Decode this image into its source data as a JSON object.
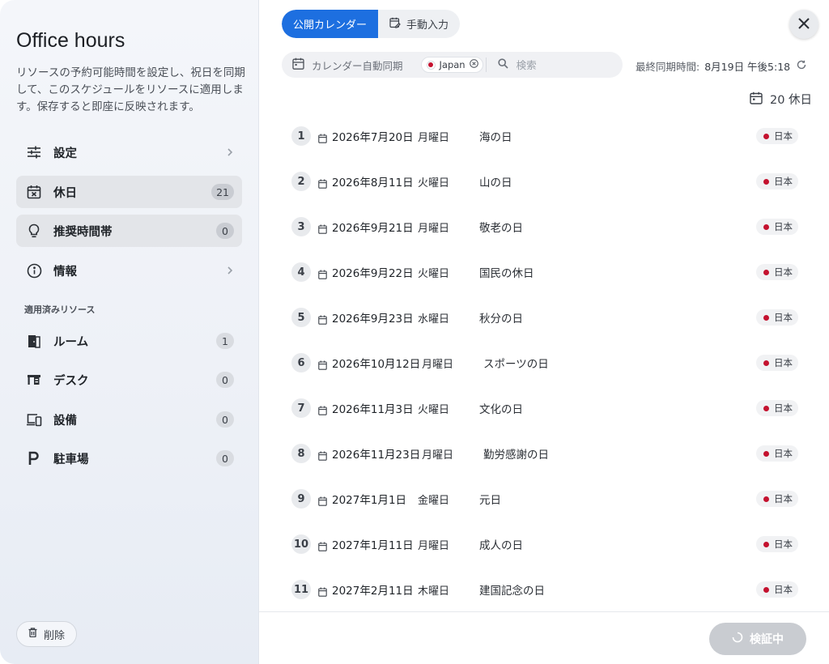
{
  "sidebar": {
    "title": "Office hours",
    "description": "リソースの予約可能時間を設定し、祝日を同期して、このスケジュールをリソースに適用します。保存すると即座に反映されます。",
    "nav": [
      {
        "label": "設定",
        "icon": "sliders-icon",
        "badge": null
      },
      {
        "label": "休日",
        "icon": "calendar-x-icon",
        "badge": "21",
        "active": true
      },
      {
        "label": "推奨時間帯",
        "icon": "lightbulb-icon",
        "badge": "0",
        "active": true
      },
      {
        "label": "情報",
        "icon": "info-icon",
        "badge": null
      }
    ],
    "resources_label": "適用済みリソース",
    "resources": [
      {
        "label": "ルーム",
        "icon": "door-icon",
        "badge": "1"
      },
      {
        "label": "デスク",
        "icon": "desk-icon",
        "badge": "0"
      },
      {
        "label": "設備",
        "icon": "devices-icon",
        "badge": "0"
      },
      {
        "label": "駐車場",
        "icon": "parking-icon",
        "badge": "0"
      }
    ],
    "delete_label": "削除"
  },
  "main": {
    "tabs": [
      {
        "label": "公開カレンダー",
        "selected": true
      },
      {
        "label": "手動入力",
        "selected": false
      }
    ],
    "filter": {
      "auto_sync_label": "カレンダー自動同期",
      "chip_label": "Japan",
      "search_placeholder": "検索"
    },
    "sync": {
      "label": "最終同期時間:",
      "value": "8月19日 午後5:18"
    },
    "count_label": "20 休日",
    "holidays": [
      {
        "num": "1",
        "date": "2026年7月20日",
        "dow": "月曜日",
        "name": "海の日",
        "region": "日本"
      },
      {
        "num": "2",
        "date": "2026年8月11日",
        "dow": "火曜日",
        "name": "山の日",
        "region": "日本"
      },
      {
        "num": "3",
        "date": "2026年9月21日",
        "dow": "月曜日",
        "name": "敬老の日",
        "region": "日本"
      },
      {
        "num": "4",
        "date": "2026年9月22日",
        "dow": "火曜日",
        "name": "国民の休日",
        "region": "日本"
      },
      {
        "num": "5",
        "date": "2026年9月23日",
        "dow": "水曜日",
        "name": "秋分の日",
        "region": "日本"
      },
      {
        "num": "6",
        "date": "2026年10月12日",
        "dow": "月曜日",
        "name": "スポーツの日",
        "region": "日本"
      },
      {
        "num": "7",
        "date": "2026年11月3日",
        "dow": "火曜日",
        "name": "文化の日",
        "region": "日本"
      },
      {
        "num": "8",
        "date": "2026年11月23日",
        "dow": "月曜日",
        "name": "勤労感謝の日",
        "region": "日本"
      },
      {
        "num": "9",
        "date": "2027年1月1日",
        "dow": "金曜日",
        "name": "元日",
        "region": "日本"
      },
      {
        "num": "10",
        "date": "2027年1月11日",
        "dow": "月曜日",
        "name": "成人の日",
        "region": "日本"
      },
      {
        "num": "11",
        "date": "2027年2月11日",
        "dow": "木曜日",
        "name": "建国記念の日",
        "region": "日本"
      }
    ],
    "verify_label": "検証中"
  },
  "colors": {
    "accent": "#1d6fe0",
    "flag_red": "#c4122f",
    "disabled_button": "#c9ccd1"
  }
}
